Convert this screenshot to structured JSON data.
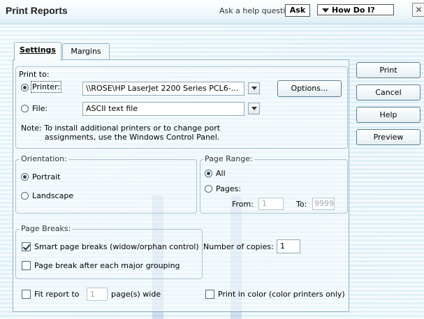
{
  "window": {
    "title": "Print Reports",
    "help_prompt": "Ask a help question",
    "ask_label": "Ask",
    "how_do_label": "How Do I?",
    "close_glyph": "✕"
  },
  "tabs": [
    {
      "label": "Settings",
      "active": true
    },
    {
      "label": "Margins",
      "active": false
    }
  ],
  "print_to": {
    "label": "Print to:",
    "printer_label": "Printer:",
    "printer_value": "\\\\ROSE\\HP LaserJet 2200 Series PCL6-...",
    "printer_selected": true,
    "options_label": "Options...",
    "file_label": "File:",
    "file_value": "ASCII text file",
    "note_line1": "Note: To install additional printers or to change port",
    "note_line2": "assignments, use the Windows Control Panel."
  },
  "orientation": {
    "label": "Orientation:",
    "portrait": "Portrait",
    "landscape": "Landscape",
    "selected": "Portrait"
  },
  "page_range": {
    "label": "Page Range:",
    "all": "All",
    "pages": "Pages:",
    "from_label": "From:",
    "from_value": "1",
    "to_label": "To:",
    "to_value": "9999",
    "selected": "All"
  },
  "page_breaks": {
    "label": "Page Breaks:",
    "smart": "Smart page breaks (widow/orphan control)",
    "smart_checked": true,
    "after_group": "Page break after each major grouping",
    "after_group_checked": false
  },
  "copies": {
    "label": "Number of copies:",
    "value": "1"
  },
  "fit": {
    "prefix": "Fit report to",
    "value": "1",
    "suffix": "page(s) wide",
    "checked": false
  },
  "color": {
    "label": "Print in color (color printers only)",
    "checked": false
  },
  "side_buttons": {
    "print": "Print",
    "cancel": "Cancel",
    "help": "Help",
    "preview": "Preview"
  }
}
